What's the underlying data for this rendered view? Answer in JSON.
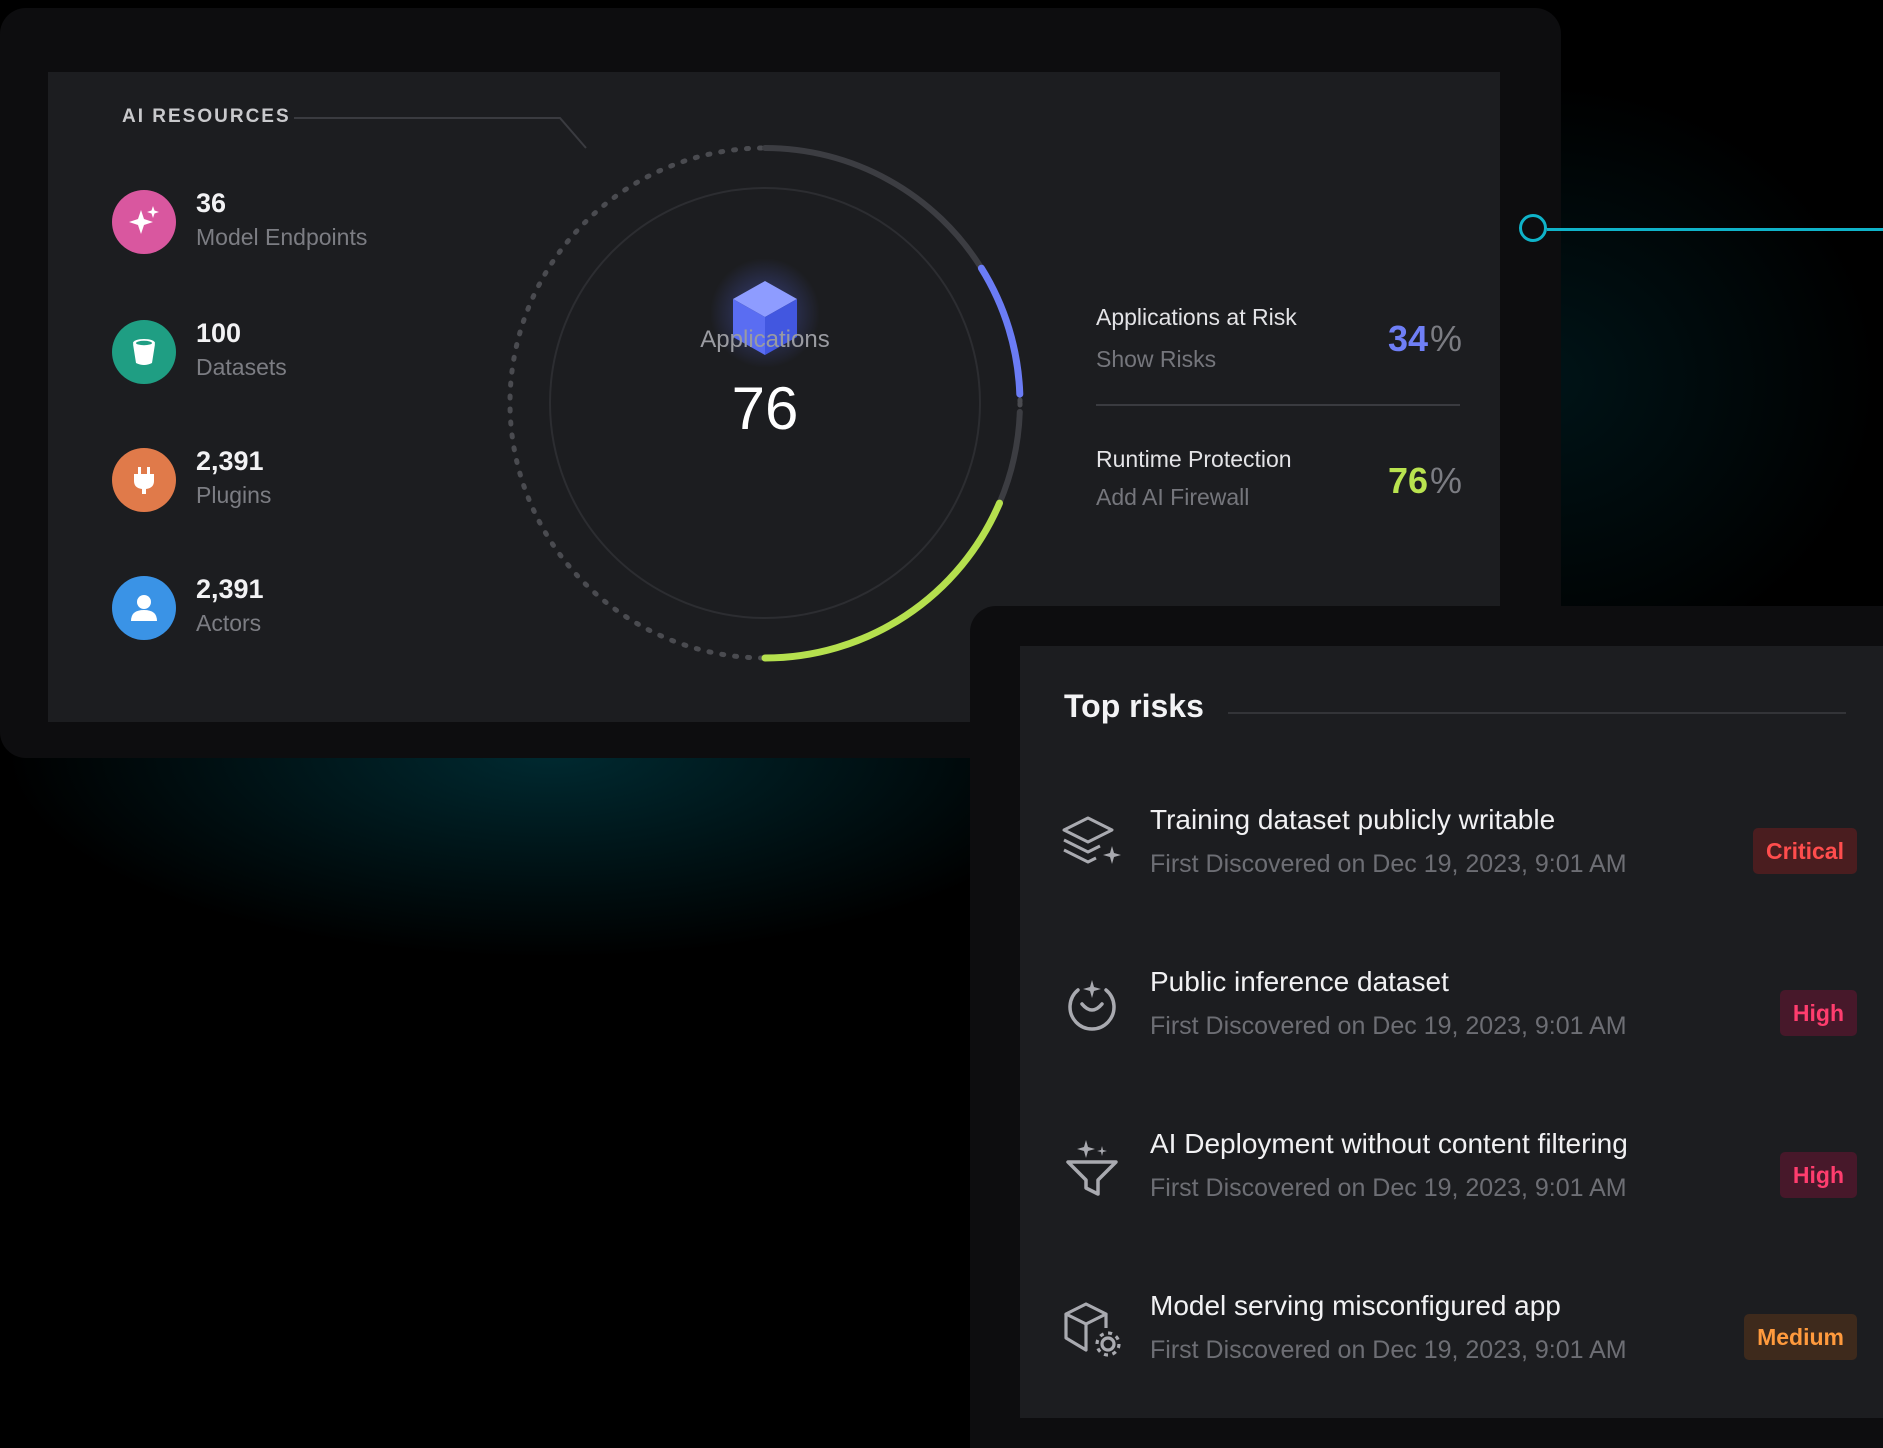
{
  "resources_panel": {
    "section_label": "AI RESOURCES",
    "items": [
      {
        "value": "36",
        "label": "Model Endpoints",
        "icon": "sparkles-icon",
        "color": "#d9579f"
      },
      {
        "value": "100",
        "label": "Datasets",
        "icon": "bucket-icon",
        "color": "#1f9e83"
      },
      {
        "value": "2,391",
        "label": "Plugins",
        "icon": "plug-icon",
        "color": "#e07a4a"
      },
      {
        "value": "2,391",
        "label": "Actors",
        "icon": "user-icon",
        "color": "#3a93e6"
      }
    ]
  },
  "gauge": {
    "label": "Applications",
    "value": "76",
    "risk_fraction": 0.34,
    "protection_fraction": 0.76,
    "colors": {
      "risk": "#6b7cf5",
      "protection": "#b5e04e",
      "track": "#3c3d42"
    }
  },
  "stats": [
    {
      "title": "Applications at Risk",
      "link": "Show Risks",
      "value": "34",
      "unit": "%",
      "color": "#6f7ff6"
    },
    {
      "title": "Runtime Protection",
      "link": "Add AI Firewall",
      "value": "76",
      "unit": "%",
      "color": "#b9e34f"
    }
  ],
  "top_risks": {
    "title": "Top risks",
    "items": [
      {
        "title": "Training dataset publicly writable",
        "subtitle": "First Discovered on Dec 19, 2023, 9:01 AM",
        "severity": "Critical",
        "icon": "layers-sparkle-icon"
      },
      {
        "title": "Public inference dataset",
        "subtitle": "First Discovered on Dec 19, 2023, 9:01 AM",
        "severity": "High",
        "icon": "inference-icon"
      },
      {
        "title": "AI Deployment without content filtering",
        "subtitle": "First Discovered on Dec 19, 2023, 9:01 AM",
        "severity": "High",
        "icon": "funnel-sparkle-icon"
      },
      {
        "title": "Model serving misconfigured app",
        "subtitle": "First Discovered on Dec 19, 2023, 9:01 AM",
        "severity": "Medium",
        "icon": "box-gear-icon"
      }
    ]
  },
  "accent_color": "#0fb3c9"
}
